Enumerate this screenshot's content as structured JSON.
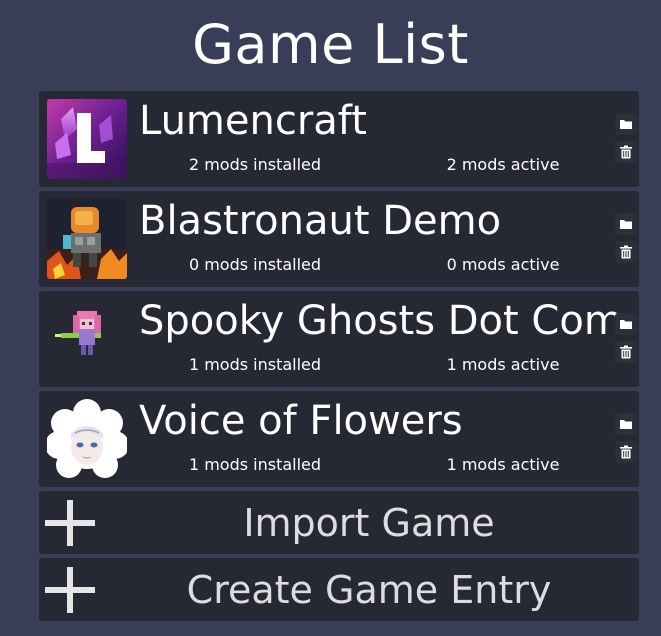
{
  "title": "Game List",
  "games": [
    {
      "name": "Lumencraft",
      "mods_installed": "2 mods installed",
      "mods_active": "2 mods active",
      "thumbnail_icon": "lumencraft-logo"
    },
    {
      "name": "Blastronaut Demo",
      "mods_installed": "0 mods installed",
      "mods_active": "0 mods active",
      "thumbnail_icon": "blastronaut-character"
    },
    {
      "name": "Spooky Ghosts Dot Com",
      "mods_installed": "1 mods installed",
      "mods_active": "1 mods active",
      "thumbnail_icon": "pink-ghost-character"
    },
    {
      "name": "Voice of Flowers",
      "mods_installed": "1 mods installed",
      "mods_active": "1 mods active",
      "thumbnail_icon": "white-haired-character"
    }
  ],
  "actions": {
    "import_label": "Import Game",
    "create_label": "Create Game Entry"
  },
  "colors": {
    "background": "#383e57",
    "row_background": "#262833",
    "text": "#ffffff"
  }
}
